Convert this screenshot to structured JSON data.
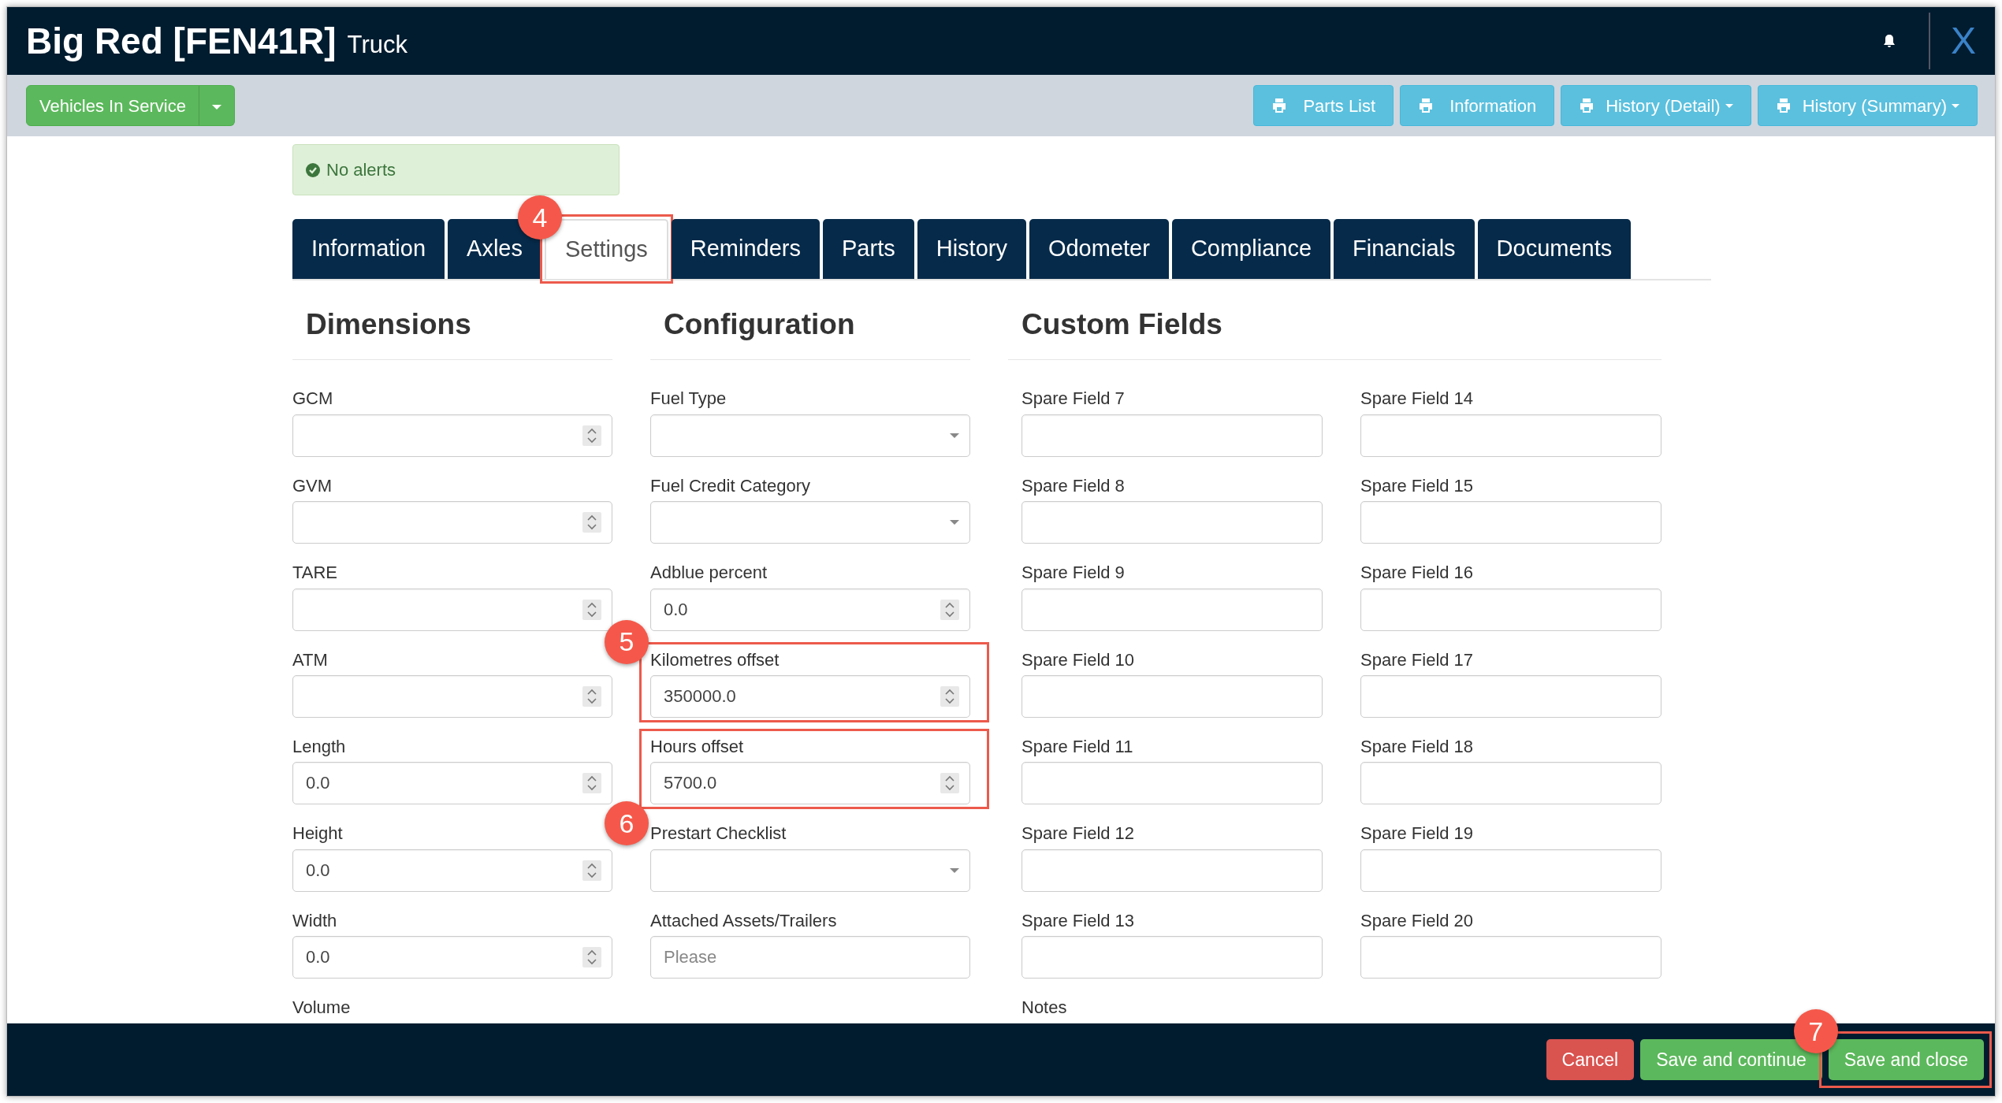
{
  "header": {
    "title": "Big Red [FEN41R]",
    "subtitle": "Truck",
    "close": "X"
  },
  "status_button": {
    "label": "Vehicles In Service"
  },
  "print_buttons": [
    {
      "label": "Parts List",
      "dropdown": false
    },
    {
      "label": "Information",
      "dropdown": false
    },
    {
      "label": "History (Detail)",
      "dropdown": true
    },
    {
      "label": "History (Summary)",
      "dropdown": true
    }
  ],
  "alert": {
    "text": "No alerts"
  },
  "tabs": [
    {
      "label": "Information",
      "selected": false
    },
    {
      "label": "Axles",
      "selected": false
    },
    {
      "label": "Settings",
      "selected": true,
      "callout": {
        "number": "4"
      }
    },
    {
      "label": "Reminders",
      "selected": false
    },
    {
      "label": "Parts",
      "selected": false
    },
    {
      "label": "History",
      "selected": false
    },
    {
      "label": "Odometer",
      "selected": false
    },
    {
      "label": "Compliance",
      "selected": false
    },
    {
      "label": "Financials",
      "selected": false
    },
    {
      "label": "Documents",
      "selected": false
    }
  ],
  "sections": [
    {
      "title": "Dimensions",
      "columns": [
        [
          {
            "label": "GCM",
            "kind": "number"
          },
          {
            "label": "GVM",
            "kind": "number"
          },
          {
            "label": "TARE",
            "kind": "number"
          },
          {
            "label": "ATM",
            "kind": "number"
          },
          {
            "label": "Length",
            "kind": "number",
            "value": "0.0"
          },
          {
            "label": "Height",
            "kind": "number",
            "value": "0.0"
          },
          {
            "label": "Width",
            "kind": "number",
            "value": "0.0"
          },
          {
            "label": "Volume",
            "kind": "cut"
          }
        ]
      ]
    },
    {
      "title": "Configuration",
      "columns": [
        [
          {
            "label": "Fuel Type",
            "kind": "select"
          },
          {
            "label": "Fuel Credit Category",
            "kind": "select"
          },
          {
            "label": "Adblue percent",
            "kind": "number",
            "value": "0.0"
          },
          {
            "label": "Kilometres offset",
            "kind": "number",
            "value": "350000.0",
            "callout": {
              "number": "5"
            }
          },
          {
            "label": "Hours offset",
            "kind": "number",
            "value": "5700.0",
            "callout": {
              "number": "6"
            }
          },
          {
            "label": "Prestart Checklist",
            "kind": "select"
          },
          {
            "label": "Attached Assets/Trailers",
            "kind": "text",
            "placeholder": "Please"
          }
        ]
      ]
    },
    {
      "title": "Custom Fields",
      "columns": [
        [
          {
            "label": "Spare Field 7",
            "kind": "text"
          },
          {
            "label": "Spare Field 8",
            "kind": "text"
          },
          {
            "label": "Spare Field 9",
            "kind": "text"
          },
          {
            "label": "Spare Field 10",
            "kind": "text"
          },
          {
            "label": "Spare Field 11",
            "kind": "text"
          },
          {
            "label": "Spare Field 12",
            "kind": "text"
          },
          {
            "label": "Spare Field 13",
            "kind": "text"
          },
          {
            "label": "Notes",
            "kind": "cut"
          }
        ],
        [
          {
            "label": "Spare Field 14",
            "kind": "text"
          },
          {
            "label": "Spare Field 15",
            "kind": "text"
          },
          {
            "label": "Spare Field 16",
            "kind": "text"
          },
          {
            "label": "Spare Field 17",
            "kind": "text"
          },
          {
            "label": "Spare Field 18",
            "kind": "text"
          },
          {
            "label": "Spare Field 19",
            "kind": "text"
          },
          {
            "label": "Spare Field 20",
            "kind": "text"
          }
        ]
      ]
    }
  ],
  "footer_buttons": [
    {
      "label": "Cancel",
      "kind": "danger"
    },
    {
      "label": "Save and continue",
      "kind": "success"
    },
    {
      "label": "Save and close",
      "kind": "success",
      "callout": {
        "number": "7"
      }
    }
  ]
}
